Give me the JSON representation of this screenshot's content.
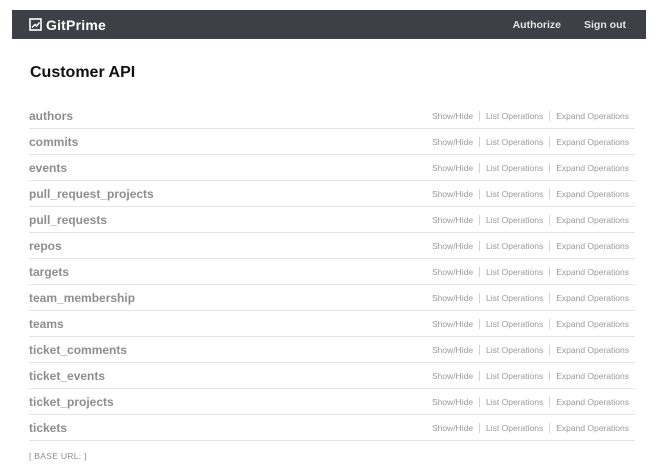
{
  "header": {
    "brand": "GitPrime",
    "logo_icon": "gitprime-logo-icon",
    "nav": [
      {
        "label": "Authorize"
      },
      {
        "label": "Sign out"
      }
    ]
  },
  "page": {
    "title": "Customer API"
  },
  "resources": [
    {
      "name": "authors",
      "show_hide": "Show/Hide",
      "list_ops": "List Operations",
      "expand_ops": "Expand Operations"
    },
    {
      "name": "commits",
      "show_hide": "Show/Hide",
      "list_ops": "List Operations",
      "expand_ops": "Expand Operations"
    },
    {
      "name": "events",
      "show_hide": "Show/Hide",
      "list_ops": "List Operations",
      "expand_ops": "Expand Operations"
    },
    {
      "name": "pull_request_projects",
      "show_hide": "Show/Hide",
      "list_ops": "List Operations",
      "expand_ops": "Expand Operations"
    },
    {
      "name": "pull_requests",
      "show_hide": "Show/Hide",
      "list_ops": "List Operations",
      "expand_ops": "Expand Operations"
    },
    {
      "name": "repos",
      "show_hide": "Show/Hide",
      "list_ops": "List Operations",
      "expand_ops": "Expand Operations"
    },
    {
      "name": "targets",
      "show_hide": "Show/Hide",
      "list_ops": "List Operations",
      "expand_ops": "Expand Operations"
    },
    {
      "name": "team_membership",
      "show_hide": "Show/Hide",
      "list_ops": "List Operations",
      "expand_ops": "Expand Operations"
    },
    {
      "name": "teams",
      "show_hide": "Show/Hide",
      "list_ops": "List Operations",
      "expand_ops": "Expand Operations"
    },
    {
      "name": "ticket_comments",
      "show_hide": "Show/Hide",
      "list_ops": "List Operations",
      "expand_ops": "Expand Operations"
    },
    {
      "name": "ticket_events",
      "show_hide": "Show/Hide",
      "list_ops": "List Operations",
      "expand_ops": "Expand Operations"
    },
    {
      "name": "ticket_projects",
      "show_hide": "Show/Hide",
      "list_ops": "List Operations",
      "expand_ops": "Expand Operations"
    },
    {
      "name": "tickets",
      "show_hide": "Show/Hide",
      "list_ops": "List Operations",
      "expand_ops": "Expand Operations"
    }
  ],
  "footer": {
    "base_url": "[ BASE URL: ]"
  },
  "colors": {
    "topbar": "#3d4047",
    "resource_text": "#8e8e8e",
    "op_text": "#9a9a9a",
    "divider": "#e4e4e4"
  }
}
